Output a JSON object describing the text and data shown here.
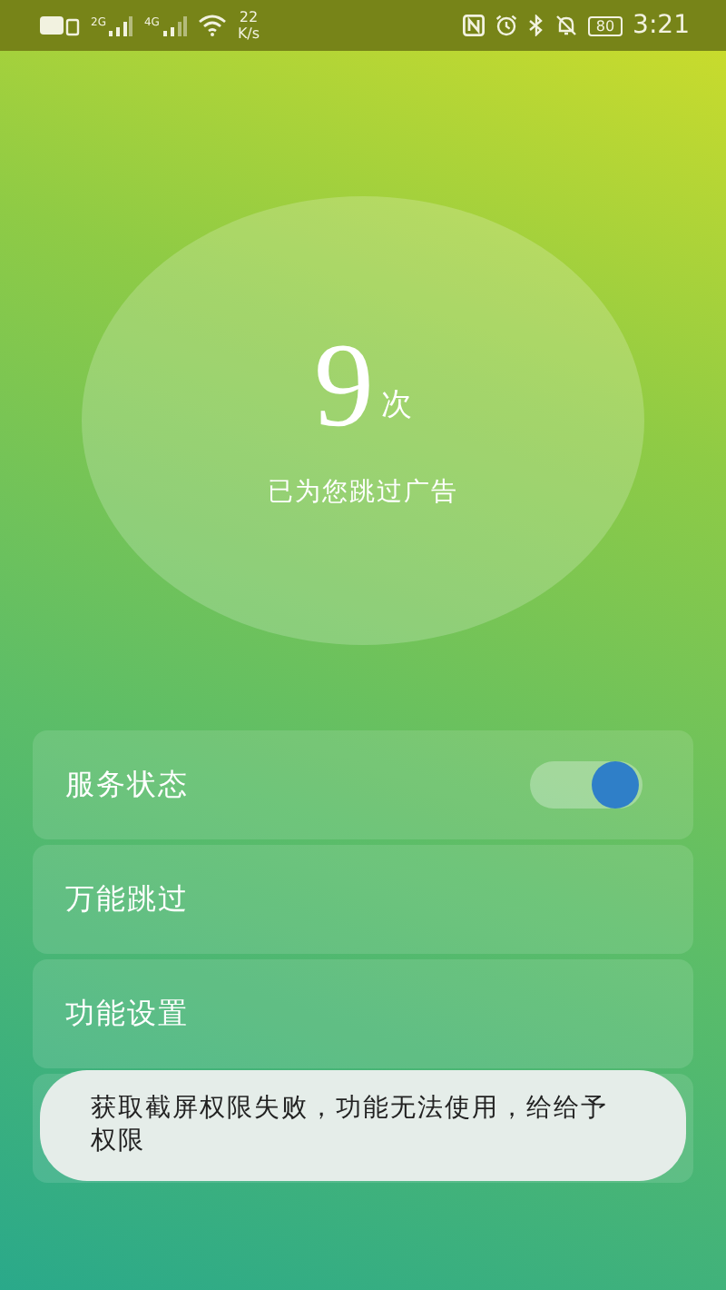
{
  "status_bar": {
    "network_2g": "2G",
    "network_4g": "4G",
    "speed_value": "22",
    "speed_unit": "K/s",
    "battery": "80",
    "time": "3:21"
  },
  "counter": {
    "count": "9",
    "unit": "次",
    "caption": "已为您跳过广告"
  },
  "settings": [
    {
      "kind": "toggle",
      "label": "服务状态",
      "on": true
    },
    {
      "kind": "link",
      "label": "万能跳过"
    },
    {
      "kind": "link",
      "label": "功能设置"
    },
    {
      "kind": "covered"
    }
  ],
  "toast": {
    "message": "获取截屏权限失败，功能无法使用，给给予权限"
  }
}
